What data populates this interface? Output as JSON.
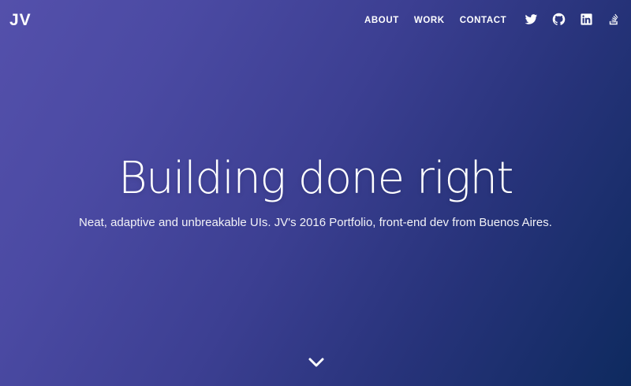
{
  "brand": {
    "logo": "JV"
  },
  "nav": {
    "items": [
      {
        "label": "ABOUT"
      },
      {
        "label": "WORK"
      },
      {
        "label": "CONTACT"
      }
    ]
  },
  "social": {
    "icons": [
      "twitter-icon",
      "github-icon",
      "linkedin-icon",
      "stackoverflow-icon"
    ]
  },
  "hero": {
    "headline": "Building done right",
    "subtitle": "Neat, adaptive and unbreakable UIs. JV's 2016 Portfolio, front-end dev from Buenos Aires."
  },
  "colors": {
    "gradient_start": "#5450ab",
    "gradient_end": "#0e2a5f",
    "text": "#ffffff"
  }
}
